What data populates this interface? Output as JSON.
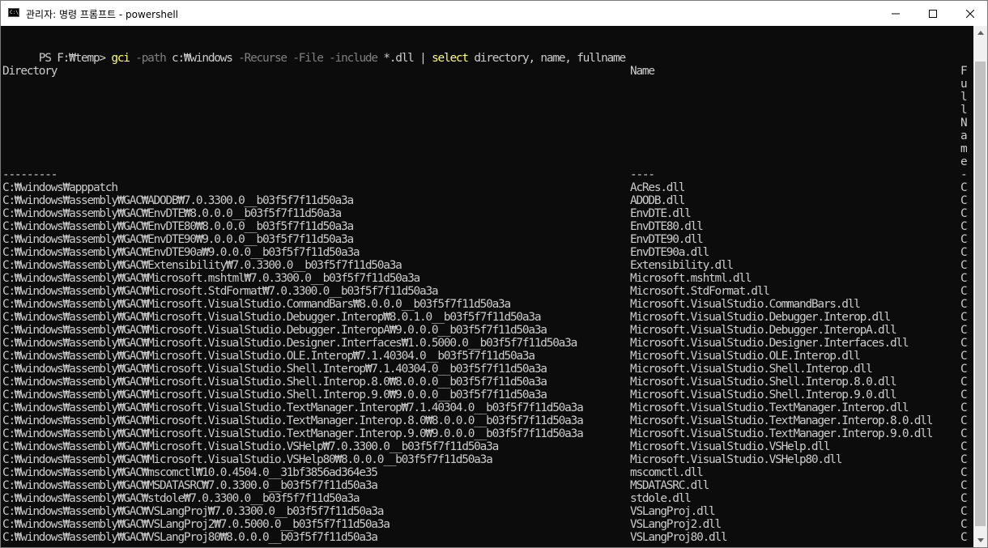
{
  "window": {
    "title": "관리자: 명령 프롬프트 - powershell",
    "app_icon_text": "C:\\"
  },
  "console": {
    "command": {
      "prompt": "PS F:₩temp> ",
      "cmd1": "gci",
      "p1": "-path",
      "a1": "c:₩windows",
      "p2": "-Recurse",
      "p3": "-File",
      "p4": "-include",
      "a2": "*.dll",
      "pipe": "|",
      "cmd2": "select",
      "a3": "directory, name, fullname"
    },
    "headers": {
      "directory": "Directory",
      "name": "Name",
      "fullname_vertical": "FullName"
    },
    "dividers": {
      "directory": "---------",
      "name": "----",
      "fullname": "-"
    },
    "rows": [
      {
        "directory": "C:₩windows₩apppatch",
        "name": "AcRes.dll",
        "fullname": "C"
      },
      {
        "directory": "C:₩windows₩assembly₩GAC₩ADODB₩7.0.3300.0__b03f5f7f11d50a3a",
        "name": "ADODB.dll",
        "fullname": "C"
      },
      {
        "directory": "C:₩windows₩assembly₩GAC₩EnvDTE₩8.0.0.0__b03f5f7f11d50a3a",
        "name": "EnvDTE.dll",
        "fullname": "C"
      },
      {
        "directory": "C:₩windows₩assembly₩GAC₩EnvDTE80₩8.0.0.0__b03f5f7f11d50a3a",
        "name": "EnvDTE80.dll",
        "fullname": "C"
      },
      {
        "directory": "C:₩windows₩assembly₩GAC₩EnvDTE90₩9.0.0.0__b03f5f7f11d50a3a",
        "name": "EnvDTE90.dll",
        "fullname": "C"
      },
      {
        "directory": "C:₩windows₩assembly₩GAC₩EnvDTE90a₩9.0.0.0__b03f5f7f11d50a3a",
        "name": "EnvDTE90a.dll",
        "fullname": "C"
      },
      {
        "directory": "C:₩windows₩assembly₩GAC₩Extensibility₩7.0.3300.0__b03f5f7f11d50a3a",
        "name": "Extensibility.dll",
        "fullname": "C"
      },
      {
        "directory": "C:₩windows₩assembly₩GAC₩Microsoft.mshtml₩7.0.3300.0__b03f5f7f11d50a3a",
        "name": "Microsoft.mshtml.dll",
        "fullname": "C"
      },
      {
        "directory": "C:₩windows₩assembly₩GAC₩Microsoft.StdFormat₩7.0.3300.0__b03f5f7f11d50a3a",
        "name": "Microsoft.StdFormat.dll",
        "fullname": "C"
      },
      {
        "directory": "C:₩windows₩assembly₩GAC₩Microsoft.VisualStudio.CommandBars₩8.0.0.0__b03f5f7f11d50a3a",
        "name": "Microsoft.VisualStudio.CommandBars.dll",
        "fullname": "C"
      },
      {
        "directory": "C:₩windows₩assembly₩GAC₩Microsoft.VisualStudio.Debugger.Interop₩8.0.1.0__b03f5f7f11d50a3a",
        "name": "Microsoft.VisualStudio.Debugger.Interop.dll",
        "fullname": "C"
      },
      {
        "directory": "C:₩windows₩assembly₩GAC₩Microsoft.VisualStudio.Debugger.InteropA₩9.0.0.0__b03f5f7f11d50a3a",
        "name": "Microsoft.VisualStudio.Debugger.InteropA.dll",
        "fullname": "C"
      },
      {
        "directory": "C:₩windows₩assembly₩GAC₩Microsoft.VisualStudio.Designer.Interfaces₩1.0.5000.0__b03f5f7f11d50a3a",
        "name": "Microsoft.VisualStudio.Designer.Interfaces.dll",
        "fullname": "C"
      },
      {
        "directory": "C:₩windows₩assembly₩GAC₩Microsoft.VisualStudio.OLE.Interop₩7.1.40304.0__b03f5f7f11d50a3a",
        "name": "Microsoft.VisualStudio.OLE.Interop.dll",
        "fullname": "C"
      },
      {
        "directory": "C:₩windows₩assembly₩GAC₩Microsoft.VisualStudio.Shell.Interop₩7.1.40304.0__b03f5f7f11d50a3a",
        "name": "Microsoft.VisualStudio.Shell.Interop.dll",
        "fullname": "C"
      },
      {
        "directory": "C:₩windows₩assembly₩GAC₩Microsoft.VisualStudio.Shell.Interop.8.0₩8.0.0.0__b03f5f7f11d50a3a",
        "name": "Microsoft.VisualStudio.Shell.Interop.8.0.dll",
        "fullname": "C"
      },
      {
        "directory": "C:₩windows₩assembly₩GAC₩Microsoft.VisualStudio.Shell.Interop.9.0₩9.0.0.0__b03f5f7f11d50a3a",
        "name": "Microsoft.VisualStudio.Shell.Interop.9.0.dll",
        "fullname": "C"
      },
      {
        "directory": "C:₩windows₩assembly₩GAC₩Microsoft.VisualStudio.TextManager.Interop₩7.1.40304.0__b03f5f7f11d50a3a",
        "name": "Microsoft.VisualStudio.TextManager.Interop.dll",
        "fullname": "C"
      },
      {
        "directory": "C:₩windows₩assembly₩GAC₩Microsoft.VisualStudio.TextManager.Interop.8.0₩8.0.0.0__b03f5f7f11d50a3a",
        "name": "Microsoft.VisualStudio.TextManager.Interop.8.0.dll",
        "fullname": "C"
      },
      {
        "directory": "C:₩windows₩assembly₩GAC₩Microsoft.VisualStudio.TextManager.Interop.9.0₩9.0.0.0__b03f5f7f11d50a3a",
        "name": "Microsoft.VisualStudio.TextManager.Interop.9.0.dll",
        "fullname": "C"
      },
      {
        "directory": "C:₩windows₩assembly₩GAC₩Microsoft.VisualStudio.VSHelp₩7.0.3300.0__b03f5f7f11d50a3a",
        "name": "Microsoft.VisualStudio.VSHelp.dll",
        "fullname": "C"
      },
      {
        "directory": "C:₩windows₩assembly₩GAC₩Microsoft.VisualStudio.VSHelp80₩8.0.0.0__b03f5f7f11d50a3a",
        "name": "Microsoft.VisualStudio.VSHelp80.dll",
        "fullname": "C"
      },
      {
        "directory": "C:₩windows₩assembly₩GAC₩mscomctl₩10.0.4504.0__31bf3856ad364e35",
        "name": "mscomctl.dll",
        "fullname": "C"
      },
      {
        "directory": "C:₩windows₩assembly₩GAC₩MSDATASRC₩7.0.3300.0__b03f5f7f11d50a3a",
        "name": "MSDATASRC.dll",
        "fullname": "C"
      },
      {
        "directory": "C:₩windows₩assembly₩GAC₩stdole₩7.0.3300.0__b03f5f7f11d50a3a",
        "name": "stdole.dll",
        "fullname": "C"
      },
      {
        "directory": "C:₩windows₩assembly₩GAC₩VSLangProj₩7.0.3300.0__b03f5f7f11d50a3a",
        "name": "VSLangProj.dll",
        "fullname": "C"
      },
      {
        "directory": "C:₩windows₩assembly₩GAC₩VSLangProj2₩7.0.5000.0__b03f5f7f11d50a3a",
        "name": "VSLangProj2.dll",
        "fullname": "C"
      },
      {
        "directory": "C:₩windows₩assembly₩GAC₩VSLangProj80₩8.0.0.0__b03f5f7f11d50a3a",
        "name": "VSLangProj80.dll",
        "fullname": "C"
      }
    ]
  },
  "colors": {
    "console_bg": "#0c0c0c",
    "text": "#cccccc",
    "command_keyword": "#ffff66",
    "parameter": "#808080"
  }
}
